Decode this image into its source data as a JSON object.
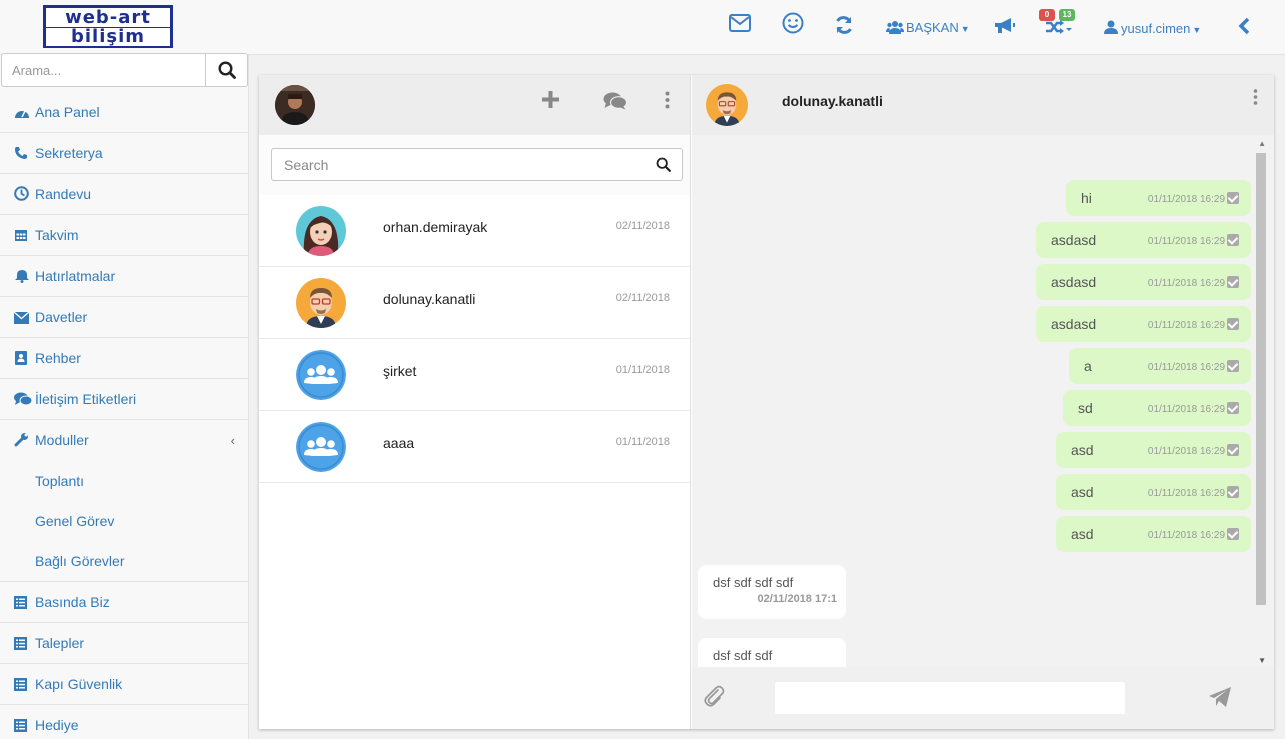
{
  "topbar": {
    "logo": {
      "line1": "web-art",
      "line2": "bilişim"
    },
    "icons": [
      "envelope-icon",
      "smiley-icon",
      "refresh-icon",
      "users-icon",
      "megaphone-icon",
      "shuffle-icon",
      "user-icon",
      "chevron-left-icon"
    ],
    "role_label": "BAŞKAN",
    "badge_red": "0",
    "badge_green": "13",
    "user_label": "yusuf.cimen",
    "accent_color": "#3a80c4"
  },
  "sidebar": {
    "search_placeholder": "Arama...",
    "items": [
      {
        "label": "Ana Panel",
        "icon": "dashboard-icon"
      },
      {
        "label": "Sekreterya",
        "icon": "phone-icon"
      },
      {
        "label": "Randevu",
        "icon": "clock-icon"
      },
      {
        "label": "Takvim",
        "icon": "calendar-icon"
      },
      {
        "label": "Hatırlatmalar",
        "icon": "bell-icon"
      },
      {
        "label": "Davetler",
        "icon": "envelope-icon"
      },
      {
        "label": "Rehber",
        "icon": "address-book-icon"
      },
      {
        "label": "İletişim Etiketleri",
        "icon": "comments-icon"
      },
      {
        "label": "Moduller",
        "icon": "wrench-icon"
      }
    ],
    "sub_items": [
      "Toplantı",
      "Genel Görev",
      "Bağlı Görevler"
    ],
    "items_after": [
      {
        "label": "Basında Biz",
        "icon": "list-icon"
      },
      {
        "label": "Talepler",
        "icon": "list-icon"
      },
      {
        "label": "Kapı Güvenlik",
        "icon": "list-icon"
      },
      {
        "label": "Hediye",
        "icon": "list-icon"
      }
    ]
  },
  "chat": {
    "search_placeholder": "Search",
    "contacts": [
      {
        "name": "orhan.demirayak",
        "date": "02/11/2018",
        "avatar": "woman-avatar"
      },
      {
        "name": "dolunay.kanatli",
        "date": "02/11/2018",
        "avatar": "man-glasses-avatar"
      },
      {
        "name": "şirket",
        "date": "01/11/2018",
        "avatar": "group-avatar"
      },
      {
        "name": "aaaa",
        "date": "01/11/2018",
        "avatar": "group-avatar"
      }
    ],
    "peer_name": "dolunay.kanatli",
    "outgoing": [
      {
        "text": "hi",
        "time": "01/11/2018 16:29"
      },
      {
        "text": "asdasd",
        "time": "01/11/2018 16:29"
      },
      {
        "text": "asdasd",
        "time": "01/11/2018 16:29"
      },
      {
        "text": "asdasd",
        "time": "01/11/2018 16:29"
      },
      {
        "text": "a",
        "time": "01/11/2018 16:29"
      },
      {
        "text": "sd",
        "time": "01/11/2018 16:29"
      },
      {
        "text": "asd",
        "time": "01/11/2018 16:29"
      },
      {
        "text": "asd",
        "time": "01/11/2018 16:29"
      },
      {
        "text": "asd",
        "time": "01/11/2018 16:29"
      }
    ],
    "incoming": [
      {
        "text": "dsf sdf sdf sdf",
        "time": "02/11/2018 17:1"
      },
      {
        "text": "dsf sdf sdf",
        "time": ""
      }
    ],
    "out_bubble_color": "#dcf8c6"
  }
}
